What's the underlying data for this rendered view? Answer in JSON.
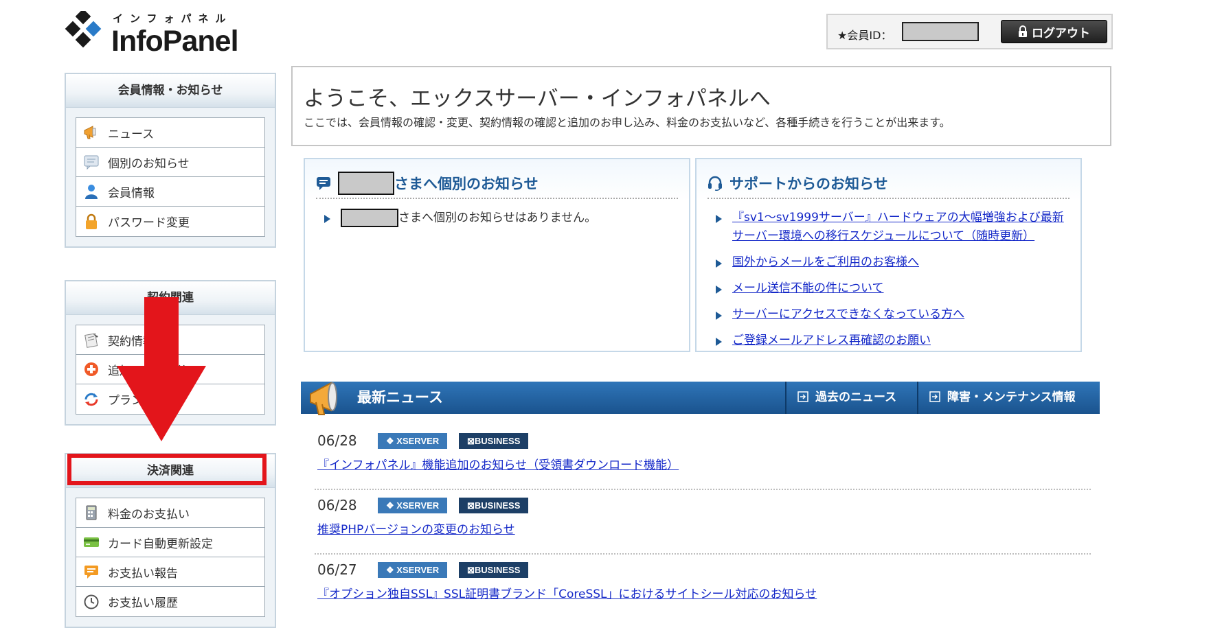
{
  "header": {
    "logo_kana": "インフォパネル",
    "logo_text": "InfoPanel",
    "member_label": "★会員ID：",
    "logout_label": "ログアウト"
  },
  "sidebar": {
    "sections": [
      {
        "title": "会員情報・お知らせ",
        "items": [
          {
            "label": "ニュース",
            "icon": "megaphone-icon"
          },
          {
            "label": "個別のお知らせ",
            "icon": "message-icon"
          },
          {
            "label": "会員情報",
            "icon": "user-icon"
          },
          {
            "label": "パスワード変更",
            "icon": "lock-icon"
          }
        ]
      },
      {
        "title": "契約関連",
        "items": [
          {
            "label": "契約情報",
            "icon": "contract-icon"
          },
          {
            "label": "追加のお申し込み",
            "icon": "add-icon"
          },
          {
            "label": "プラン変更",
            "icon": "refresh-icon"
          }
        ]
      },
      {
        "title": "決済関連",
        "items": [
          {
            "label": "料金のお支払い",
            "icon": "calculator-icon"
          },
          {
            "label": "カード自動更新設定",
            "icon": "credit-card-icon"
          },
          {
            "label": "お支払い報告",
            "icon": "report-icon"
          },
          {
            "label": "お支払い履歴",
            "icon": "clock-icon"
          }
        ]
      }
    ]
  },
  "welcome": {
    "title": "ようこそ、エックスサーバー・インフォパネルへ",
    "description": "ここでは、会員情報の確認・変更、契約情報の確認と追加のお申し込み、料金のお支払いなど、各種手続きを行うことが出来ます。"
  },
  "personal_notice": {
    "title_suffix": "さまへ個別のお知らせ",
    "empty_message": "さまへ個別のお知らせはありません。"
  },
  "support_notice": {
    "title": "サポートからのお知らせ",
    "links": [
      "『sv1～sv1999サーバー』ハードウェアの大幅増強および最新サーバー環境への移行スケジュールについて（随時更新）",
      "国外からメールをご利用のお客様へ",
      "メール送信不能の件について",
      "サーバーにアクセスできなくなっている方へ",
      "ご登録メールアドレス再確認のお願い"
    ]
  },
  "news": {
    "title": "最新ニュース",
    "tab_past": "過去のニュース",
    "tab_maintenance": "障害・メンテナンス情報",
    "tag_xserver": "XSERVER",
    "tag_business": "BUSINESS",
    "items": [
      {
        "date": "06/28",
        "title": "『インフォパネル』機能追加のお知らせ（受領書ダウンロード機能）"
      },
      {
        "date": "06/28",
        "title": "推奨PHPバージョンの変更のお知らせ"
      },
      {
        "date": "06/27",
        "title": "『オプション独自SSL』SSL証明書ブランド「CoreSSL」におけるサイトシール対応のお知らせ"
      }
    ]
  },
  "colors": {
    "accent": "#1e5a96",
    "news_bar": "#2368a8",
    "link": "#1428c8",
    "annotation": "#e3151b"
  }
}
